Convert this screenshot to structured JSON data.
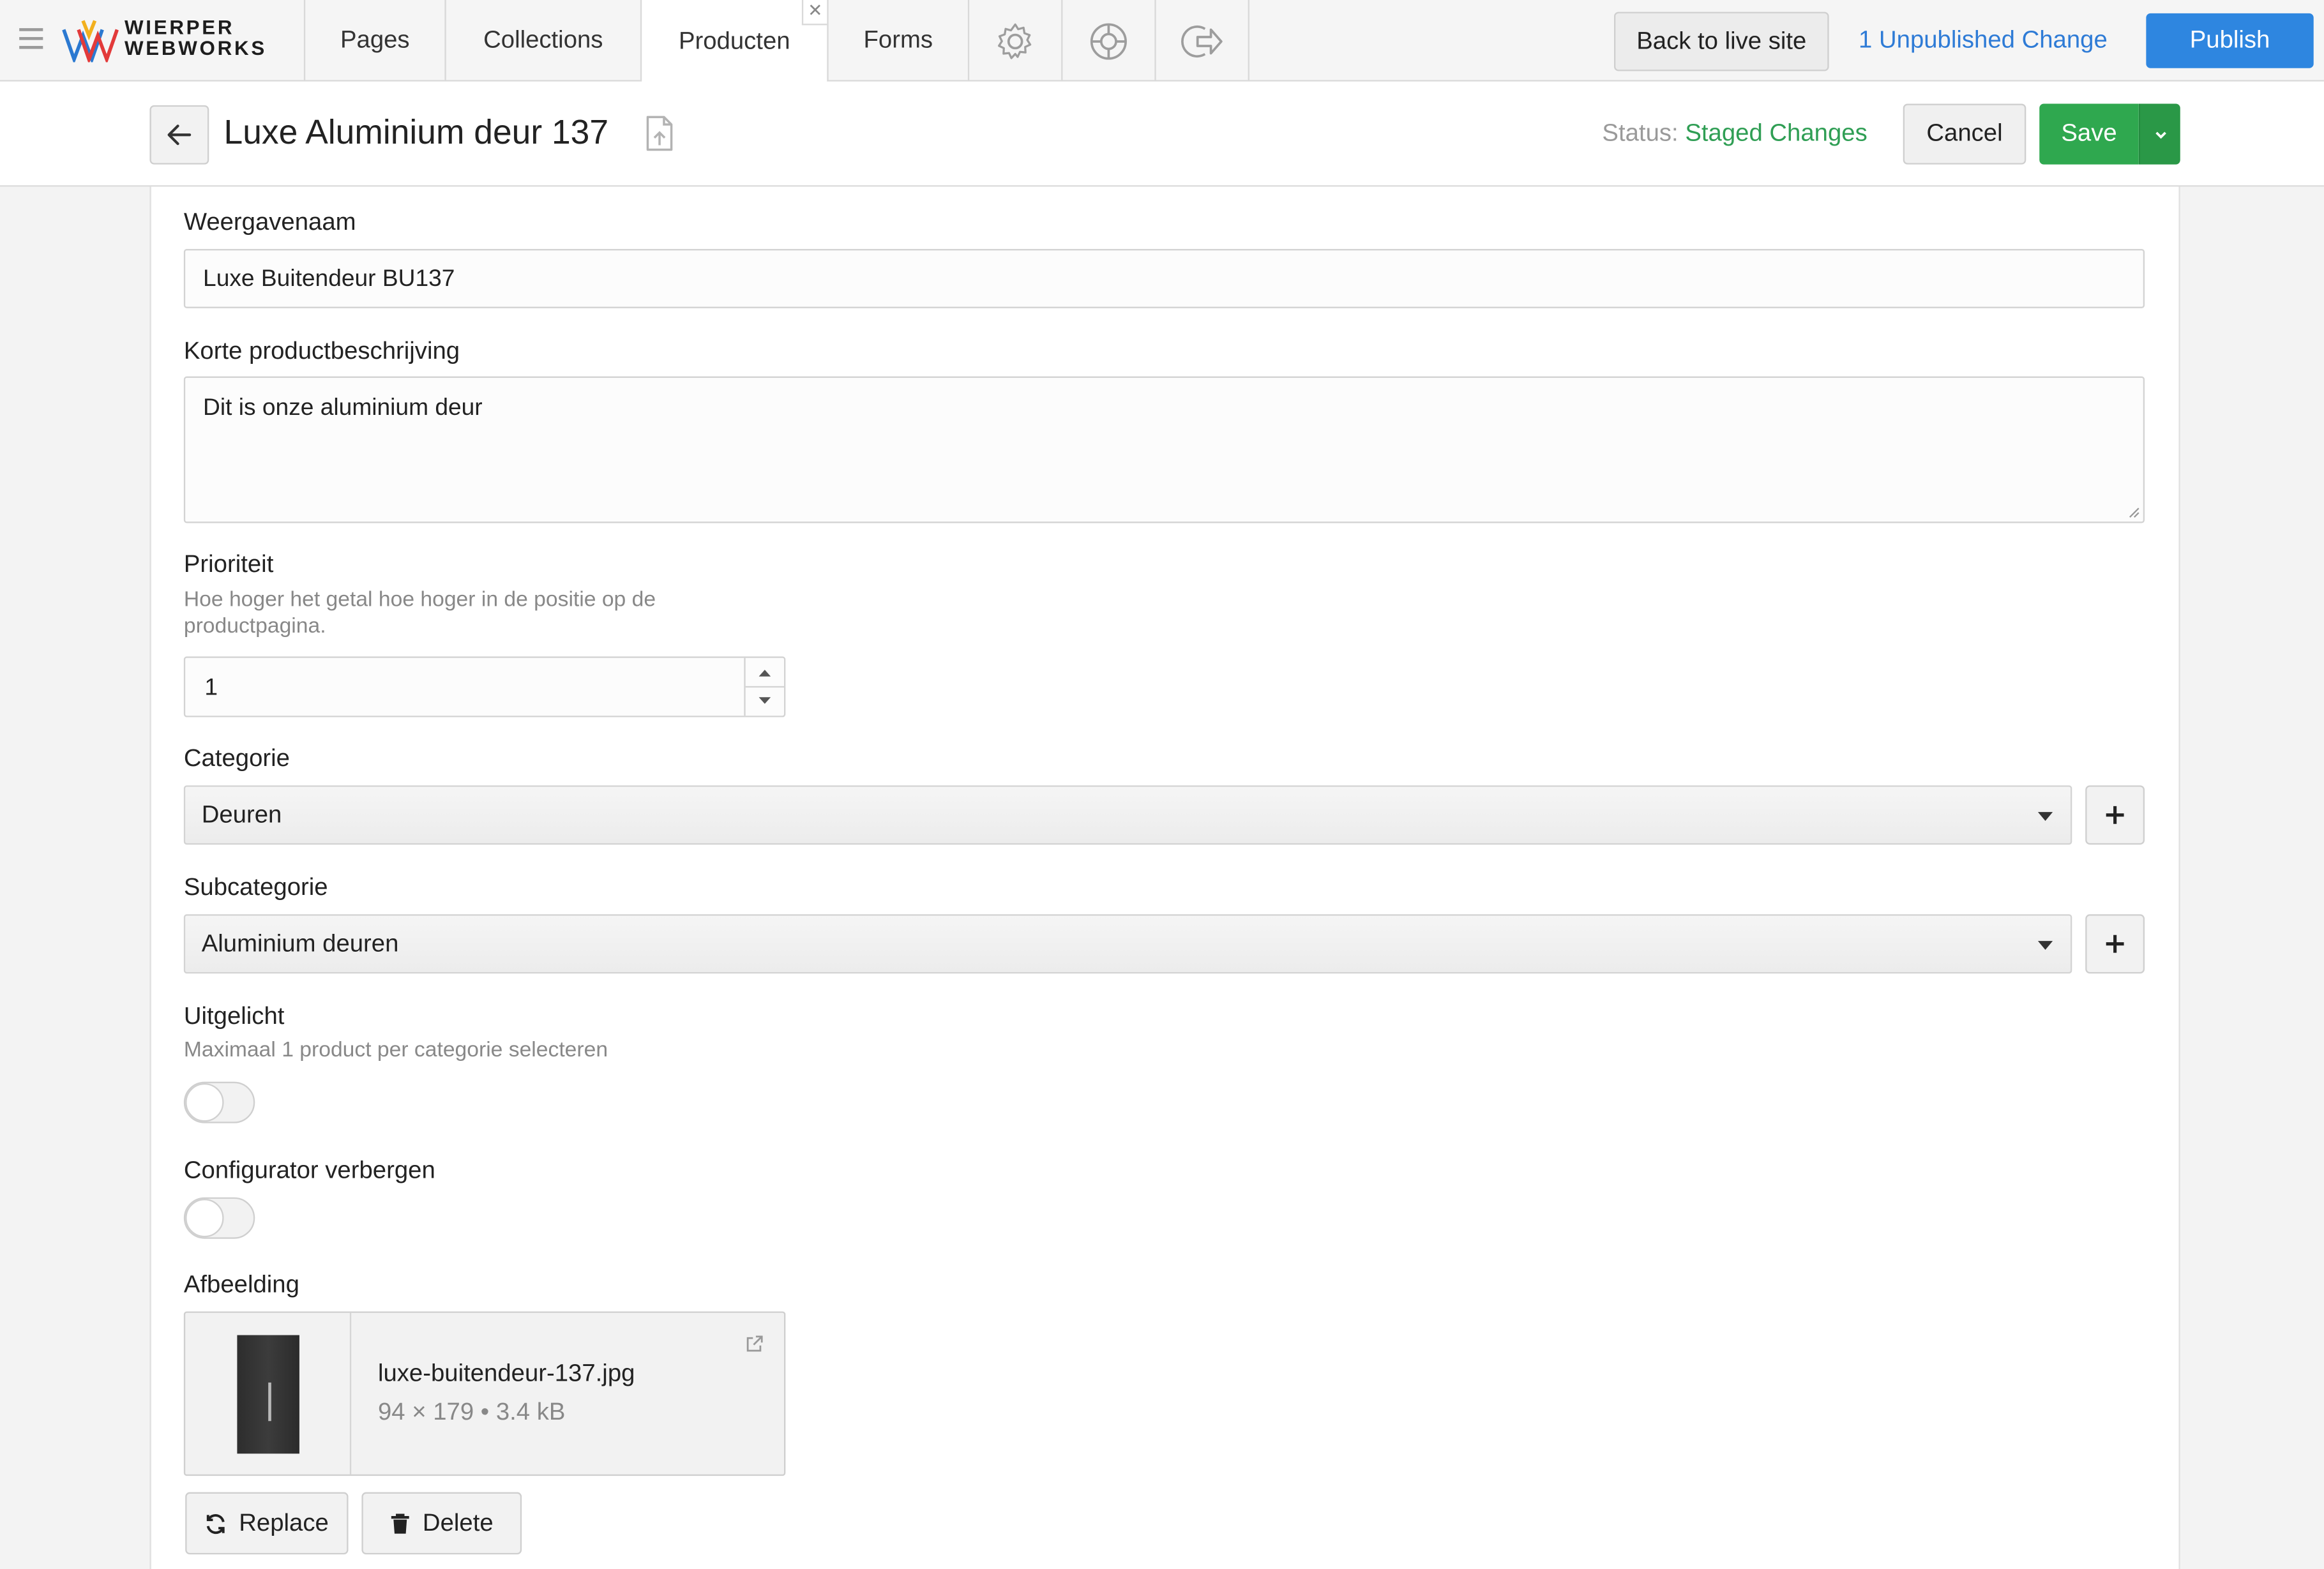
{
  "brand": {
    "line1": "WIERPER",
    "line2": "WEBWORKS"
  },
  "nav": {
    "tabs": [
      {
        "label": "Pages"
      },
      {
        "label": "Collections"
      },
      {
        "label": "Producten",
        "active": true
      },
      {
        "label": "Forms"
      }
    ],
    "icons": [
      "gear-icon",
      "help-lifebuoy-icon",
      "logout-icon"
    ]
  },
  "topbar": {
    "back_to_live": "Back to live site",
    "unpublished": "1 Unpublished Change",
    "publish": "Publish"
  },
  "header": {
    "title": "Luxe Aluminium deur 137",
    "status_label": "Status:",
    "status_value": "Staged Changes",
    "cancel": "Cancel",
    "save": "Save"
  },
  "form": {
    "weergavenaam": {
      "label": "Weergavenaam",
      "value": "Luxe Buitendeur BU137"
    },
    "korte_beschrijving": {
      "label": "Korte productbeschrijving",
      "value": "Dit is onze aluminium deur"
    },
    "prioriteit": {
      "label": "Prioriteit",
      "hint": "Hoe hoger het getal hoe hoger in de positie op de productpagina.",
      "value": "1"
    },
    "categorie": {
      "label": "Categorie",
      "value": "Deuren"
    },
    "subcategorie": {
      "label": "Subcategorie",
      "value": "Aluminium deuren"
    },
    "uitgelicht": {
      "label": "Uitgelicht",
      "hint": "Maximaal 1 product per categorie selecteren",
      "on": false
    },
    "configurator_verbergen": {
      "label": "Configurator verbergen",
      "on": false
    },
    "afbeelding": {
      "label": "Afbeelding",
      "filename": "luxe-buitendeur-137.jpg",
      "info": "94 × 179 • 3.4 kB",
      "replace": "Replace",
      "delete": "Delete"
    }
  },
  "colors": {
    "publish": "#2e86e0",
    "save": "#2fa84f",
    "status": "#2f9e54",
    "link": "#2e7bd6"
  }
}
